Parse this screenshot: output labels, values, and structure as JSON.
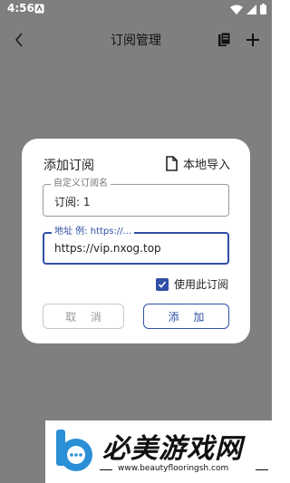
{
  "status": {
    "time": "4:56"
  },
  "appbar": {
    "title": "订阅管理"
  },
  "dialog": {
    "title": "添加订阅",
    "local_import": "本地导入",
    "name_field": {
      "label": "自定义订阅名",
      "value": "订阅: 1"
    },
    "url_field": {
      "label": "地址 例: https://...",
      "value": "https://vip.nxog.top"
    },
    "checkbox": {
      "label": "使用此订阅",
      "checked": true
    },
    "cancel_label": "取 消",
    "add_label": "添 加"
  },
  "watermark": {
    "title": "必美游戏网",
    "url": "www.beautyflooringsh.com"
  },
  "colors": {
    "accent": "#2f4fa6",
    "scrim": "rgba(0,0,0,0.5)",
    "statusbar_text": "#ffffff"
  },
  "icons": [
    "back-arrow-icon",
    "documents-icon",
    "plus-icon",
    "file-icon",
    "checkmark-icon",
    "wifi-icon",
    "signal-icon",
    "battery-icon",
    "notification-icon"
  ]
}
